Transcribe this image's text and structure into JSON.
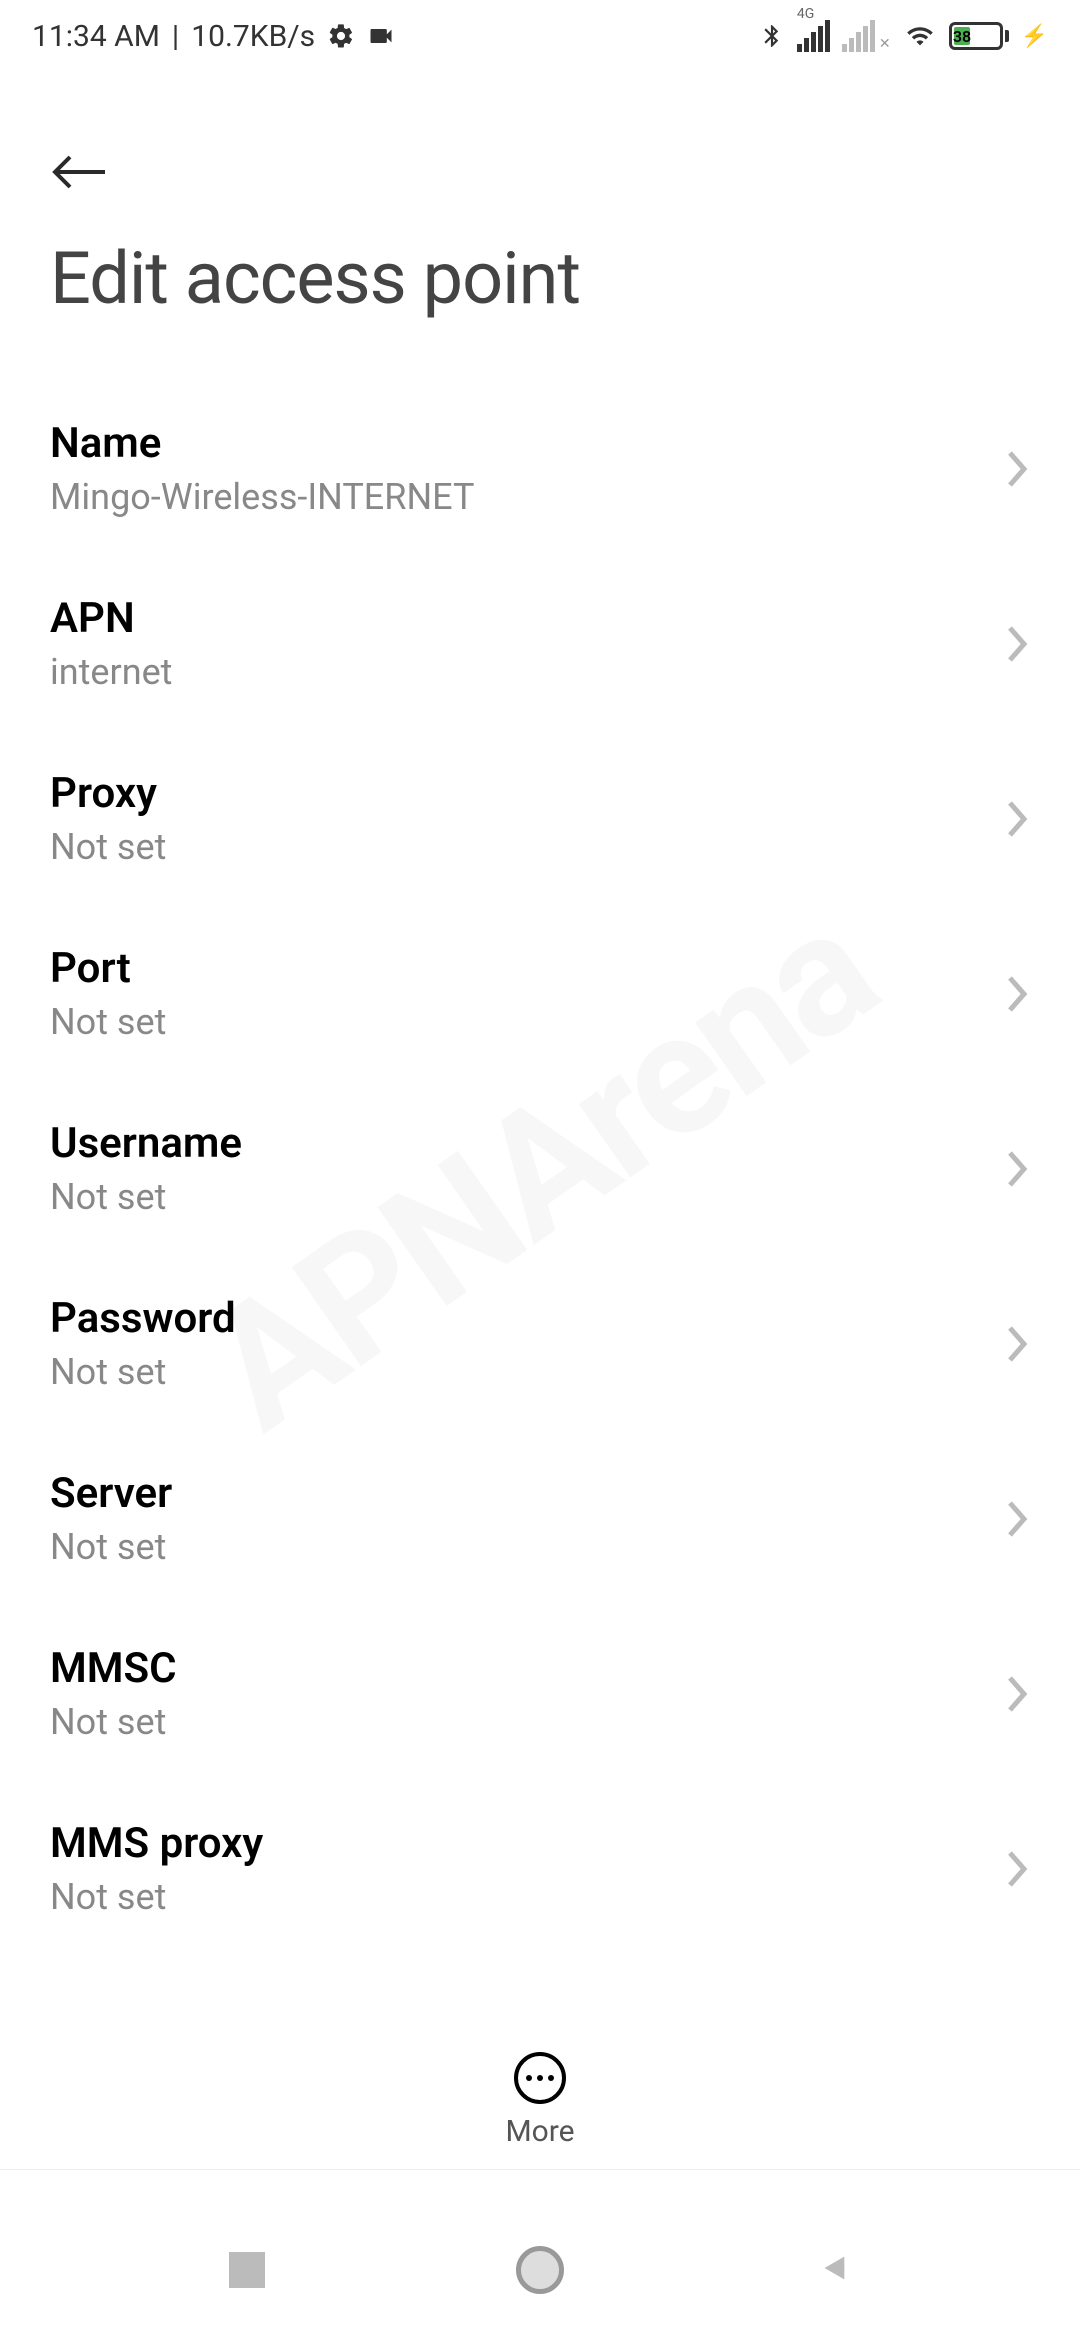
{
  "statusbar": {
    "time": "11:34 AM",
    "speed": "10.7KB/s",
    "network_type": "4G",
    "battery_pct": "38"
  },
  "header": {
    "title": "Edit access point"
  },
  "settings": [
    {
      "label": "Name",
      "value": "Mingo-Wireless-INTERNET"
    },
    {
      "label": "APN",
      "value": "internet"
    },
    {
      "label": "Proxy",
      "value": "Not set"
    },
    {
      "label": "Port",
      "value": "Not set"
    },
    {
      "label": "Username",
      "value": "Not set"
    },
    {
      "label": "Password",
      "value": "Not set"
    },
    {
      "label": "Server",
      "value": "Not set"
    },
    {
      "label": "MMSC",
      "value": "Not set"
    },
    {
      "label": "MMS proxy",
      "value": "Not set"
    }
  ],
  "bottom": {
    "more_label": "More"
  },
  "watermark": "APNArena"
}
